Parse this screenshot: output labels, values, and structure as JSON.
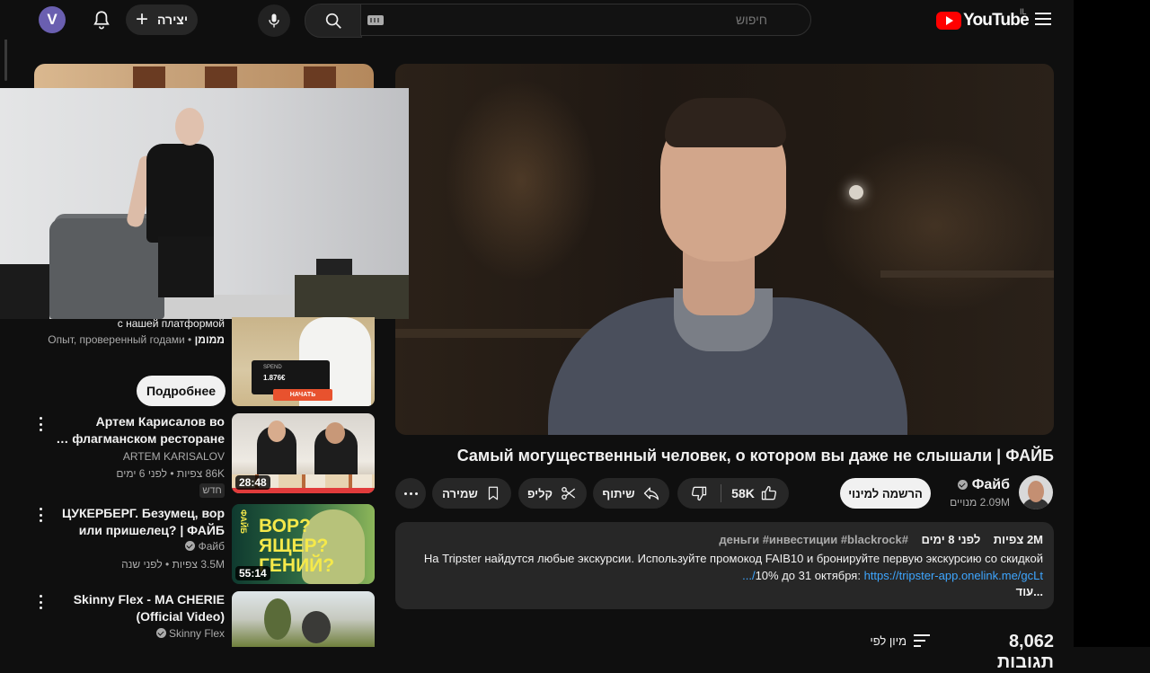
{
  "header": {
    "avatar_letter": "V",
    "create_label": "יצירה",
    "create_plus": "+",
    "search_placeholder": "חיפוש",
    "logo_text": "YouTube",
    "country_code": "IL"
  },
  "colors": {
    "background": "#0f0f0f",
    "accent_red": "#ff0000",
    "link_blue": "#3ea6ff",
    "avatar_purple": "#6a5fb0",
    "pill_bg": "#272727"
  },
  "icons": [
    "avatar",
    "bell-icon",
    "plus-icon",
    "mic-icon",
    "search-icon",
    "keyboard-icon",
    "youtube-logo-icon",
    "menu-icon",
    "verified-icon",
    "thumb-up-icon",
    "thumb-down-icon",
    "share-icon",
    "scissors-icon",
    "bookmark-icon",
    "more-icon",
    "sort-icon"
  ],
  "ad": {
    "line1": "с нашей платформой",
    "advertiser": "ממומן",
    "line2": "Опыт, проверенный годами",
    "button": "Подробнее",
    "thumb_spend": "SPEND",
    "thumb_amount": "1.876€",
    "thumb_button": "НАЧАТЬ"
  },
  "suggestions": [
    {
      "title": "Артем Карисалов во флагманском ресторане …",
      "channel": "ARTEM KARISALOV",
      "meta": "86K צפיות • לפני 6 ימים",
      "badge": "חדש",
      "duration": "28:48"
    },
    {
      "title": "ЦУКЕРБЕРГ. Безумец, вор или пришелец? | ФАЙБ",
      "channel": "Файб",
      "meta": "3.5M צפיות • לפני שנה",
      "duration": "55:14",
      "thumb_text": "ВОР?\nЯЩЕР?\nГЕНИЙ?",
      "thumb_side_text": "ФАЙБ"
    },
    {
      "title": "Skinny Flex - MA CHERIE (Official Video)",
      "channel": "Skinny Flex"
    }
  ],
  "video": {
    "title": "Самый могущественный человек, о котором вы даже не слышали | ФАЙБ",
    "channel_name": "Файб",
    "subscribers": "2.09M מנויים",
    "subscribe_label": "הרשמה למינוי",
    "likes": "58K",
    "share_label": "שיתוף",
    "clip_label": "קליפ",
    "save_label": "שמירה"
  },
  "description": {
    "views": "2M צפיות",
    "date": "לפני 8 ימים",
    "hashtags": "#деньги #инвестиции #blackrock",
    "body": "На Tripster найдутся любые экскурсии. Используйте промокод FAIB10 и бронируйте первую экскурсию со скидкой 10% до 31 октября: ",
    "link": "https://tripster-app.onelink.me/gcLt/...",
    "more": "...עוד"
  },
  "comments": {
    "count_label": "8,062 תגובות",
    "sort_label": "מיון לפי"
  }
}
